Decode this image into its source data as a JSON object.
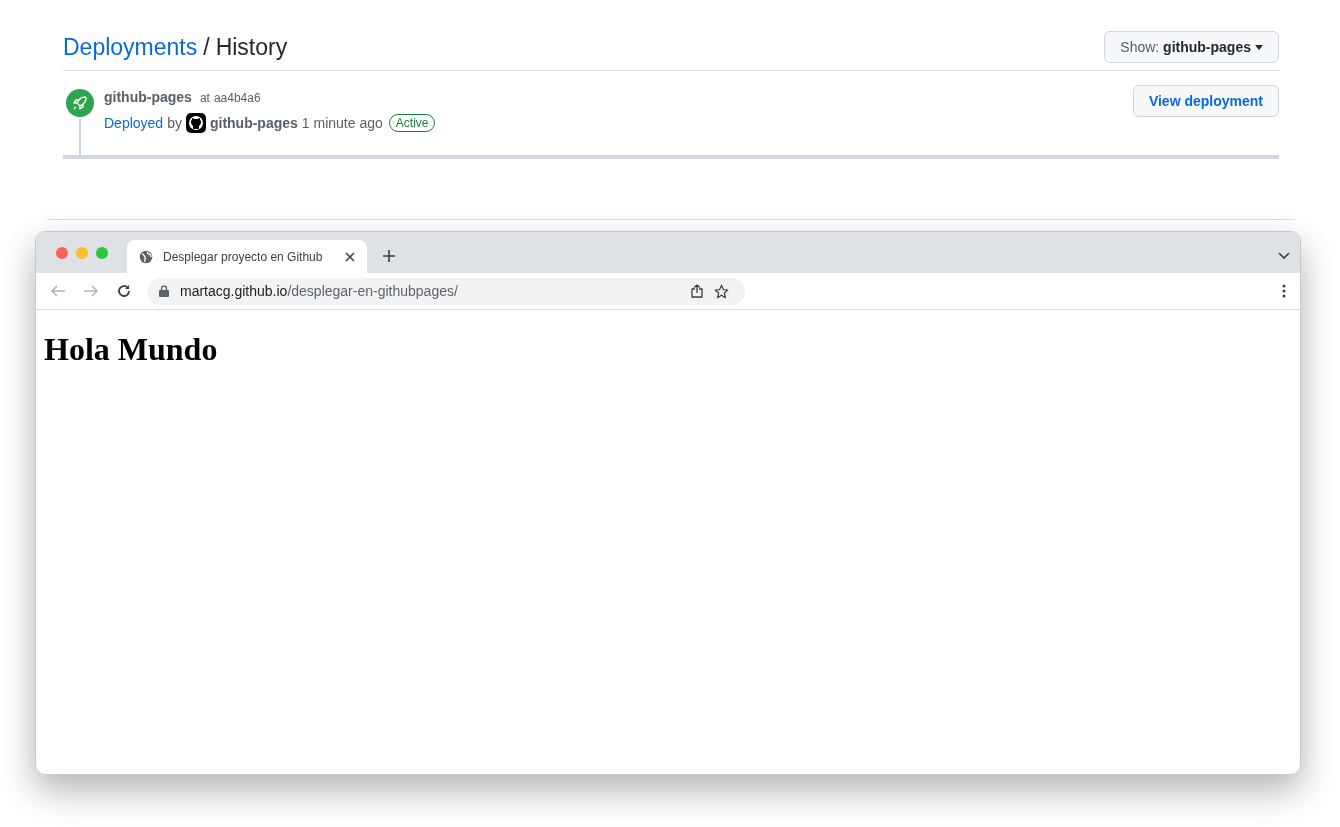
{
  "header": {
    "breadcrumb_link": "Deployments",
    "separator": "/",
    "title": "History",
    "filter_button": "Show: **github-pages**"
  },
  "deployments": [
    {
      "environment": "github-pages",
      "commit_prefix": "at",
      "commit": "aa4b4a6",
      "status_link": "Deployed",
      "by": "by",
      "author": "github-pages",
      "time": "1 minute ago",
      "badge": "Active",
      "button": "View deployment"
    }
  ],
  "browser": {
    "tabs": [
      {
        "title": "Desplegar proyecto en Github",
        "selected": true
      }
    ],
    "url_host": "martacg.github.io",
    "url_path": "/desplegar-en-githubpages/",
    "page_heading": "Hola Mundo"
  }
}
